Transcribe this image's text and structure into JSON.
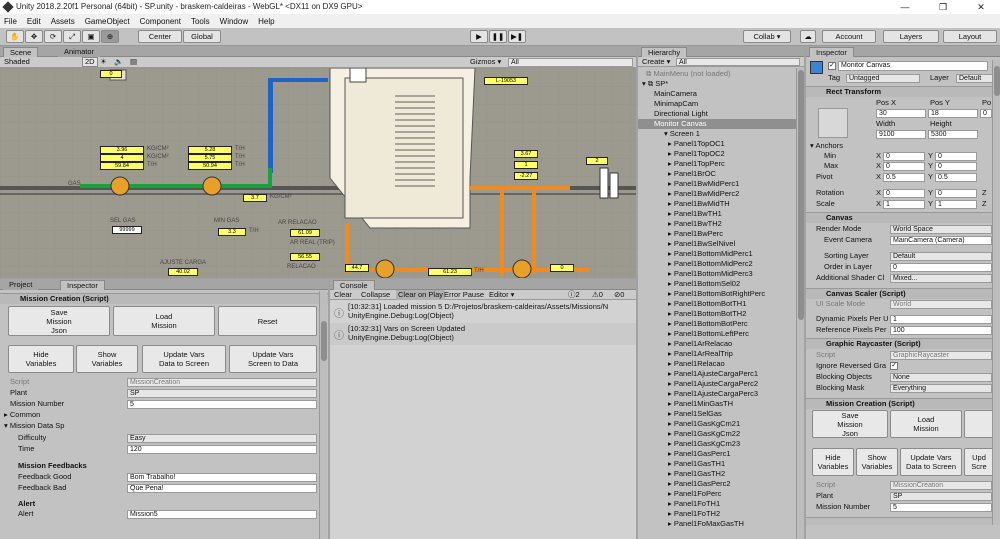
{
  "window": {
    "title": "Unity 2018.2.20f1 Personal (64bit) - SP.unity - braskem-caldeiras - WebGL* <DX11 on DX9 GPU>",
    "minimize": "—",
    "maximize": "❐",
    "close": "✕"
  },
  "menu": [
    "File",
    "Edit",
    "Assets",
    "GameObject",
    "Component",
    "Tools",
    "Window",
    "Help"
  ],
  "toolbar": {
    "center": "Center",
    "global": "Global",
    "play": "▶",
    "pause": "❚❚",
    "step": "▶❚",
    "collab": "Collab ▾",
    "account": "Account",
    "layers": "Layers",
    "layout": "Layout"
  },
  "scene": {
    "tab_scene": "Scene",
    "tab_animator": "Animator",
    "shading": "Shaded",
    "mode_2d": "2D",
    "gizmos": "Gizmos ▾",
    "search": "All",
    "values": {
      "a1": "3.96",
      "a2": "4",
      "a3": "59.84",
      "b1": "5.28",
      "b2": "5.75",
      "b3": "50.94",
      "c1": "3.7",
      "d1": "99999",
      "e1": "3.3",
      "f1": "61.09",
      "f2": "56.55",
      "g1": "40.02",
      "h1": "44.7",
      "i1": "61.23",
      "j1": "0",
      "k1": "3.67",
      "k2": "1",
      "k3": "-2.27",
      "l1": "L-19053",
      "m1": "2",
      "top1": "0"
    },
    "units": {
      "kgcm": "KG/CM²",
      "th": "T/H"
    },
    "labels": {
      "gas": "GAS",
      "sel_gas": "SEL GAS",
      "min_gas": "MIN GAS",
      "ar_relacao": "AR RELACAO",
      "ar_real": "AR REAL (TRIP)",
      "ajuste": "AJUSTE CARGA",
      "relacao": "RELACAO"
    }
  },
  "project_tab": "Project",
  "inspector_tab": "Inspector",
  "left_inspector": {
    "title": "Mission Creation (Script)",
    "buttons": {
      "save": "Save\nMission\nJson",
      "load": "Load\nMission",
      "reset": "Reset",
      "hide": "Hide\nVariables",
      "show": "Show\nVariables",
      "update_screen": "Update Vars\nData to Screen",
      "update_data": "Update Vars\nScreen to Data"
    },
    "script_label": "Script",
    "script_value": "MissionCreation",
    "plant_label": "Plant",
    "plant_value": "SP",
    "mission_number_label": "Mission Number",
    "mission_number_value": "5",
    "common": "Common",
    "mission_data": "Mission Data Sp",
    "difficulty_label": "Difficulty",
    "difficulty_value": "Easy",
    "time_label": "Time",
    "time_value": "120",
    "feedbacks": "Mission Feedbacks",
    "fb_good_label": "Feedback Good",
    "fb_good_value": "Bom Trabalho!",
    "fb_bad_label": "Feedback Bad",
    "fb_bad_value": "Que Pena!",
    "alert_header": "Alert",
    "alert_label": "Alert",
    "alert_value": "Mission5"
  },
  "console": {
    "tab": "Console",
    "clear": "Clear",
    "collapse": "Collapse",
    "clear_on_play": "Clear on Play",
    "error_pause": "Error Pause",
    "editor": "Editor ▾",
    "count_msg": "2",
    "count_warn": "0",
    "count_err": "0",
    "entries": [
      {
        "line1": "[10:32:31] Loaded mission 5 D:/Projetos/braskem-caldeiras/Assets/Missions/N",
        "line2": "UnityEngine.Debug:Log(Object)"
      },
      {
        "line1": "[10:32:31] Vars on Screen Updated",
        "line2": "UnityEngine.Debug:Log(Object)"
      }
    ]
  },
  "hierarchy": {
    "tab": "Hierarchy",
    "create": "Create ▾",
    "search": "All",
    "items": [
      "MainMenu (not loaded)",
      "SP*",
      "MainCamera",
      "MinimapCam",
      "Directional Light",
      "Monitor Canvas",
      "Screen 1",
      "Panel1TopOC1",
      "Panel1TopOC2",
      "Panel1TopPerc",
      "Panel1BrOC",
      "Panel1BwMidPerc1",
      "Panel1BwMidPerc2",
      "Panel1BwMidTH",
      "Panel1BwTH1",
      "Panel1BwTH2",
      "Panel1BwPerc",
      "Panel1BwSelNivel",
      "Panel1BottomMidPerc1",
      "Panel1BottomMidPerc2",
      "Panel1BottomMidPerc3",
      "Panel1BottomSel02",
      "Panel1BottomBotRightPerc",
      "Panel1BottomBotTH1",
      "Panel1BottomBotTH2",
      "Panel1BottomBotPerc",
      "Panel1BottomLeftPerc",
      "Panel1ArRelacao",
      "Panel1ArRealTrip",
      "Panel1Relacao",
      "Panel1AjusteCargaPerc1",
      "Panel1AjusteCargaPerc2",
      "Panel1AjusteCargaPerc3",
      "Panel1MinGasTH",
      "Panel1SelGas",
      "Panel1GasKgCm21",
      "Panel1GasKgCm22",
      "Panel1GasKgCm23",
      "Panel1GasPerc1",
      "Panel1GasTH1",
      "Panel1GasTH2",
      "Panel1GasPerc2",
      "Panel1FoPerc",
      "Panel1FoTH1",
      "Panel1FoTH2",
      "Panel1FoMaxGasTH"
    ]
  },
  "inspector": {
    "tab": "Inspector",
    "object_name": "Monitor Canvas",
    "tag_label": "Tag",
    "tag_value": "Untagged",
    "layer_label": "Layer",
    "layer_value": "Default",
    "rect": {
      "title": "Rect Transform",
      "posx_l": "Pos X",
      "posy_l": "Pos Y",
      "posz_l": "Po",
      "posx": "30",
      "posy": "18",
      "posz": "0",
      "width_l": "Width",
      "height_l": "Height",
      "width": "9100",
      "height": "5300",
      "anchors": "Anchors",
      "min": "Min",
      "max": "Max",
      "pivot": "Pivot",
      "min_x": "0",
      "min_y": "0",
      "max_x": "0",
      "max_y": "0",
      "pivot_x": "0.5",
      "pivot_y": "0.5",
      "rotation": "Rotation",
      "scale": "Scale",
      "rot_x": "0",
      "rot_y": "0",
      "scale_x": "1",
      "scale_y": "1",
      "x": "X",
      "y": "Y",
      "z": "Z"
    },
    "canvas": {
      "title": "Canvas",
      "render_mode_l": "Render Mode",
      "render_mode": "World Space",
      "event_camera_l": "Event Camera",
      "event_camera": "MainCamera (Camera)",
      "sorting_layer_l": "Sorting Layer",
      "sorting_layer": "Default",
      "order_l": "Order in Layer",
      "order": "0",
      "shader_l": "Additional Shader Cl",
      "shader": "Mixed..."
    },
    "scaler": {
      "title": "Canvas Scaler (Script)",
      "ui_scale_l": "UI Scale Mode",
      "ui_scale": "World",
      "dyn_l": "Dynamic Pixels Per U",
      "dyn": "1",
      "ref_l": "Reference Pixels Per",
      "ref": "100"
    },
    "raycaster": {
      "title": "Graphic Raycaster (Script)",
      "script_l": "Script",
      "script": "GraphicRaycaster",
      "ignore_l": "Ignore Reversed Gra",
      "blocking_l": "Blocking Objects",
      "blocking": "None",
      "mask_l": "Blocking Mask",
      "mask": "Everything"
    },
    "mission": {
      "title": "Mission Creation (Script)",
      "save": "Save\nMission\nJson",
      "load": "Load\nMission",
      "update": "Upd",
      "hide": "Hide\nVariables",
      "show": "Show\nVariables",
      "update_screen": "Update Vars\nData to Screen",
      "update_partial": "Upd\nScre",
      "script_l": "Script",
      "script": "MissionCreation",
      "plant_l": "Plant",
      "plant": "SP",
      "mission_l": "Mission Number",
      "mission": "5"
    }
  },
  "colors": {
    "accent": "#3d7bd6",
    "panel": "#c2c2c2",
    "scene_bg": "#9c9a8e"
  }
}
